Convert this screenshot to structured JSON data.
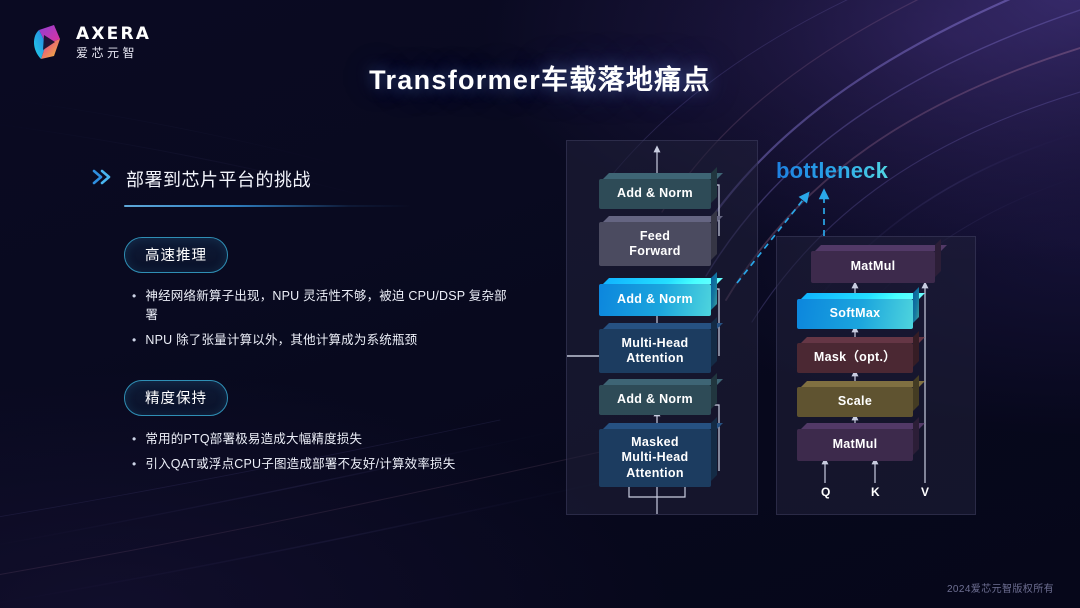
{
  "brand": {
    "name_en": "AXERA",
    "name_cn": "爱芯元智",
    "logo_icon": "axera-logo-mark",
    "colors": {
      "cyan": "#18b5d8",
      "magenta": "#e0329b",
      "yellow": "#f2c230",
      "purple": "#7b3fd4"
    }
  },
  "title": "Transformer车载落地痛点",
  "section": {
    "chevron_icon": "double-chevron-right-icon",
    "heading": "部署到芯片平台的挑战"
  },
  "groups": [
    {
      "pill": "高速推理",
      "bullets": [
        "神经网络新算子出现，NPU 灵活性不够，被迫 CPU/DSP 复杂部署",
        "NPU 除了张量计算以外，其他计算成为系统瓶颈"
      ]
    },
    {
      "pill": "精度保持",
      "bullets": [
        "常用的PTQ部署极易造成大幅精度损失",
        "引入QAT或浮点CPU子图造成部署不友好/计算效率损失"
      ]
    }
  ],
  "diagram": {
    "bottleneck_label": "bottleneck",
    "bottleneck_color": "#2aa7e8",
    "transformer_blocks": [
      {
        "label": "Add & Norm",
        "style": "addnorm",
        "highlight": false
      },
      {
        "label": "Feed\nForward",
        "style": "ff",
        "highlight": false
      },
      {
        "label": "Add & Norm",
        "style": "highlight",
        "highlight": true
      },
      {
        "label": "Multi-Head\nAttention",
        "style": "mha",
        "highlight": false
      },
      {
        "label": "Add & Norm",
        "style": "addnorm",
        "highlight": false
      },
      {
        "label": "Masked\nMulti-Head\nAttention",
        "style": "mha",
        "highlight": false
      }
    ],
    "attention_blocks": [
      {
        "label": "MatMul",
        "style": "matmul",
        "highlight": false
      },
      {
        "label": "SoftMax",
        "style": "highlight",
        "highlight": true
      },
      {
        "label": "Mask（opt.）",
        "style": "mask",
        "highlight": false
      },
      {
        "label": "Scale",
        "style": "scale",
        "highlight": false
      },
      {
        "label": "MatMul",
        "style": "matmul",
        "highlight": false
      }
    ],
    "inputs": [
      "Q",
      "K",
      "V"
    ],
    "block_labels": {
      "t0": "Add & Norm",
      "t1_a": "Feed",
      "t1_b": "Forward",
      "t2": "Add & Norm",
      "t3_a": "Multi-Head",
      "t3_b": "Attention",
      "t4": "Add & Norm",
      "t5_a": "Masked",
      "t5_b": "Multi-Head",
      "t5_c": "Attention",
      "a0": "MatMul",
      "a1": "SoftMax",
      "a2": "Mask（opt.）",
      "a3": "Scale",
      "a4": "MatMul",
      "q": "Q",
      "k": "K",
      "v": "V"
    }
  },
  "footer": "2024爱芯元智版权所有"
}
